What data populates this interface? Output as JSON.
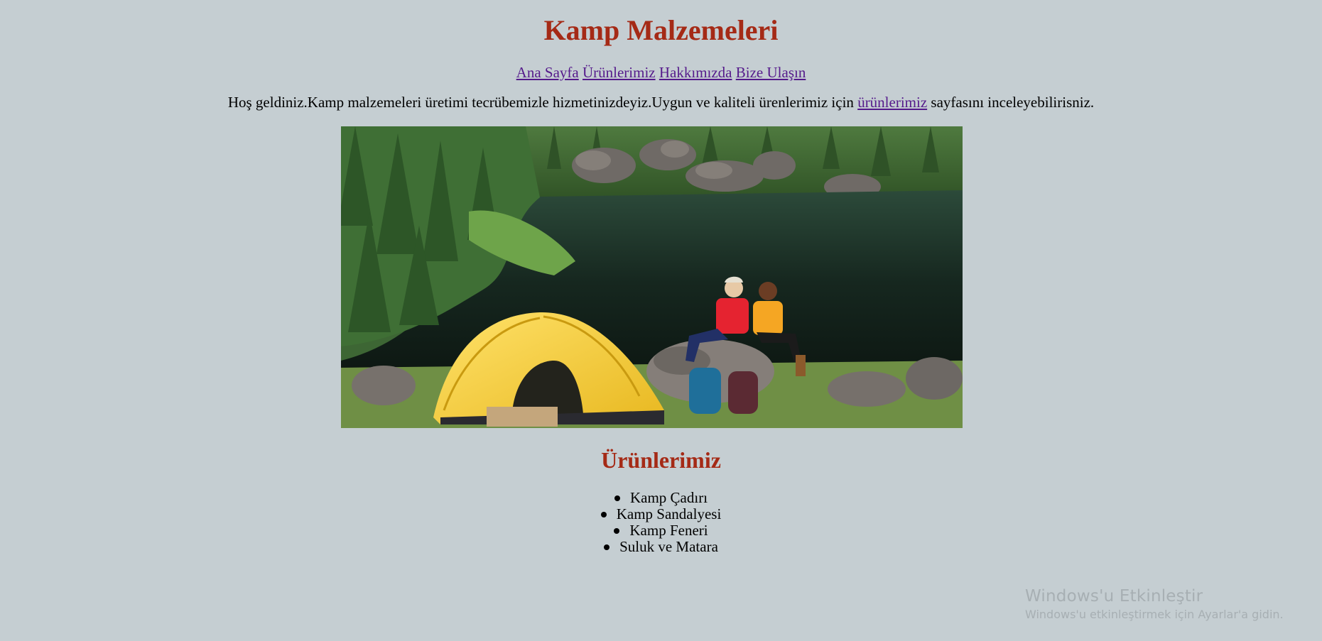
{
  "page": {
    "title": "Kamp Malzemeleri",
    "accent_color": "#a52a16",
    "background_color": "#c5ced2",
    "link_color": "#551a8b"
  },
  "nav": {
    "items": [
      "Ana Sayfa",
      "Ürünlerimiz",
      "Hakkımızda",
      "Bize Ulaşın"
    ]
  },
  "intro": {
    "before": "Hoş geldiniz.Kamp malzemeleri üretimi tecrübemizle hizmetinizdeyiz.Uygun ve kaliteli ürenlerimiz için ",
    "link": "ürünlerimiz",
    "after": " sayfasını inceleyebilirisniz."
  },
  "hero_image": {
    "icon": "camping-lake-photo"
  },
  "products": {
    "heading": "Ürünlerimiz",
    "items": [
      "Kamp Çadırı",
      "Kamp Sandalyesi",
      "Kamp Feneri",
      "Suluk ve Matara"
    ]
  },
  "watermark": {
    "title": "Windows'u Etkinleştir",
    "subtitle": "Windows'u etkinleştirmek için Ayarlar'a gidin."
  }
}
